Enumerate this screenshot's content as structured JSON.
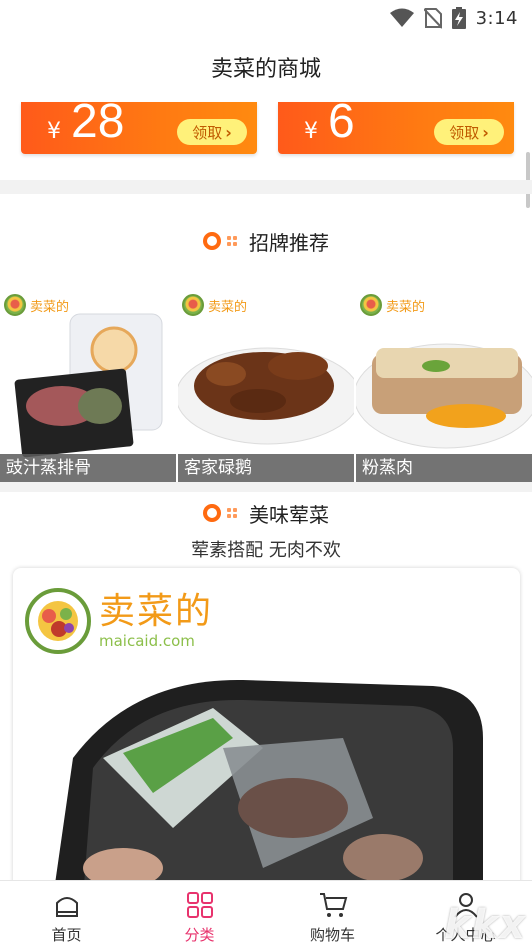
{
  "status_bar": {
    "time": "3:14",
    "icons": [
      "wifi-icon",
      "no-sim-icon",
      "battery-charging-icon"
    ]
  },
  "header": {
    "title": "卖菜的商城"
  },
  "coupons": [
    {
      "currency": "¥",
      "amount": "28",
      "action": "领取"
    },
    {
      "currency": "¥",
      "amount": "6",
      "action": "领取"
    }
  ],
  "featured": {
    "heading": "招牌推荐",
    "items": [
      {
        "name": "豉汁蒸排骨",
        "brand": "卖菜的"
      },
      {
        "name": "客家碌鹅",
        "brand": "卖菜的"
      },
      {
        "name": "粉蒸肉",
        "brand": "卖菜的"
      }
    ]
  },
  "combo": {
    "heading": "美味荤菜",
    "subtitle": "荤素搭配 无肉不欢",
    "banner": {
      "brand": "卖菜的",
      "domain": "maicaid.com"
    }
  },
  "tab_bar": {
    "tabs": [
      {
        "label": "首页",
        "icon": "home-icon",
        "active": false
      },
      {
        "label": "分类",
        "icon": "category-grid-icon",
        "active": true
      },
      {
        "label": "购物车",
        "icon": "cart-icon",
        "active": false
      },
      {
        "label": "个人中心",
        "icon": "user-icon",
        "active": false
      }
    ]
  },
  "watermark": "kkx",
  "colors": {
    "accent": "#ff6a10",
    "active_tab": "#e8336d",
    "coupon_button": "#fff17a"
  }
}
